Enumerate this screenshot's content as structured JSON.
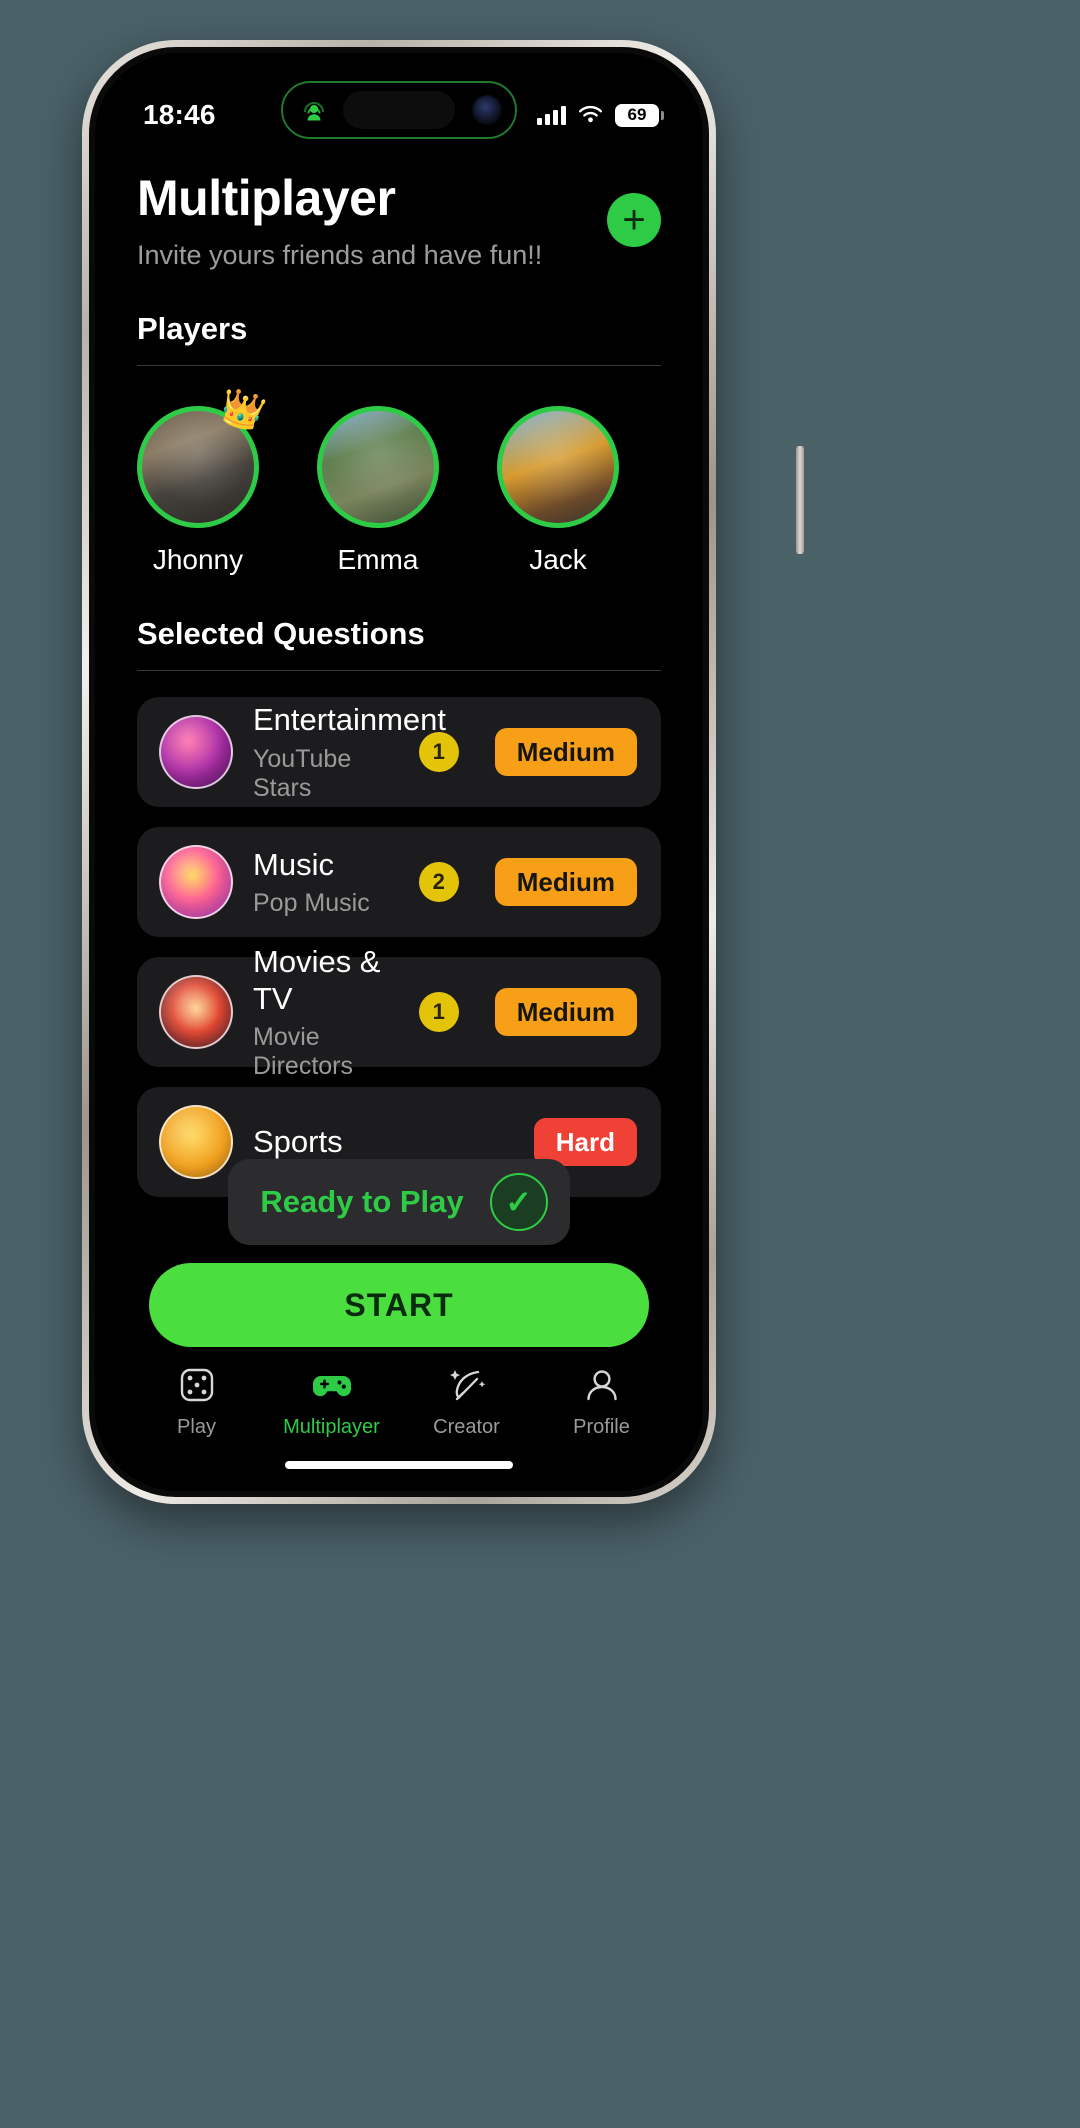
{
  "status_bar": {
    "time": "18:46",
    "battery_percent": "69",
    "signal_icon": "cellular-bars-icon",
    "wifi_icon": "wifi-icon",
    "battery_icon": "battery-icon",
    "island_activity_icon": "person-broadcast-icon",
    "island_camera_icon": "front-camera-icon"
  },
  "header": {
    "title": "Multiplayer",
    "subtitle": "Invite yours friends and have fun!!",
    "add_button_label": "+"
  },
  "players_section": {
    "title": "Players",
    "players": [
      {
        "name": "Jhonny",
        "is_host": true,
        "crown": "👑"
      },
      {
        "name": "Emma",
        "is_host": false,
        "crown": ""
      },
      {
        "name": "Jack",
        "is_host": false,
        "crown": ""
      }
    ]
  },
  "questions_section": {
    "title": "Selected Questions",
    "cards": [
      {
        "category": "Entertainment",
        "topic": "YouTube Stars",
        "count": "1",
        "difficulty": "Medium"
      },
      {
        "category": "Music",
        "topic": "Pop Music",
        "count": "2",
        "difficulty": "Medium"
      },
      {
        "category": "Movies & TV",
        "topic": "Movie Directors",
        "count": "1",
        "difficulty": "Medium"
      },
      {
        "category": "Sports",
        "topic": "",
        "count": "",
        "difficulty": "Hard"
      }
    ]
  },
  "ready_bar": {
    "label": "Ready to Play",
    "check_icon": "check-circle-icon",
    "check_glyph": "✓"
  },
  "start_button": {
    "label": "START"
  },
  "tab_bar": {
    "tabs": [
      {
        "label": "Play",
        "icon": "dice-icon",
        "active": false
      },
      {
        "label": "Multiplayer",
        "icon": "gamepad-icon",
        "active": true
      },
      {
        "label": "Creator",
        "icon": "quill-icon",
        "active": false
      },
      {
        "label": "Profile",
        "icon": "person-icon",
        "active": false
      }
    ]
  },
  "colors": {
    "accent_green": "#2ecc46",
    "start_green": "#4ade3f",
    "badge_yellow": "#e3c409",
    "pill_medium": "#f79f17",
    "pill_hard": "#ef4136",
    "card_bg": "#1c1c1e",
    "screen_bg": "#000000"
  }
}
